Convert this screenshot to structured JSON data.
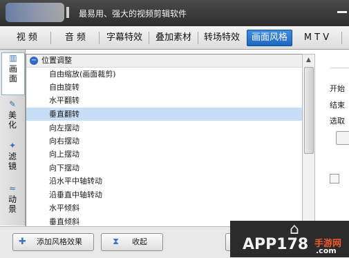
{
  "window": {
    "title": "最易用、强大的视频剪辑软件"
  },
  "tabs": [
    {
      "label": "视 频"
    },
    {
      "label": "音 频"
    },
    {
      "label": "字幕特效"
    },
    {
      "label": "叠加素材"
    },
    {
      "label": "转场特效"
    },
    {
      "label": "画面风格",
      "active": true
    },
    {
      "label": "M T V"
    }
  ],
  "side_tabs": [
    {
      "label": "画面",
      "icon": "panel-icon",
      "active": true
    },
    {
      "label": "美化",
      "icon": "magic-wand-icon"
    },
    {
      "label": "滤镜",
      "icon": "sparkle-wand-icon"
    },
    {
      "label": "动景",
      "icon": "wave-icon"
    }
  ],
  "group": {
    "label": "位置调整",
    "icon": "collapse-minus-icon"
  },
  "items": [
    "自由缩放(画面裁剪)",
    "自由旋转",
    "水平翻转",
    "垂直翻转",
    "向左摆动",
    "向右摆动",
    "向上摆动",
    "向下摆动",
    "沿水平中轴转动",
    "沿垂直中轴转动",
    "水平倾斜",
    "垂直倾斜"
  ],
  "selected_item": "垂直翻转",
  "right_panel": {
    "labels": [
      "开始",
      "结束",
      "选取"
    ]
  },
  "buttons": {
    "add_style": "添加风格效果",
    "collapse": "收起"
  },
  "watermark": {
    "main": "APP178",
    "sub": "手游网",
    "domain": ".com"
  },
  "colors": {
    "active_tab": "#2a78d2",
    "selected_row": "#c7def6",
    "watermark_accent": "#f05a2a"
  }
}
